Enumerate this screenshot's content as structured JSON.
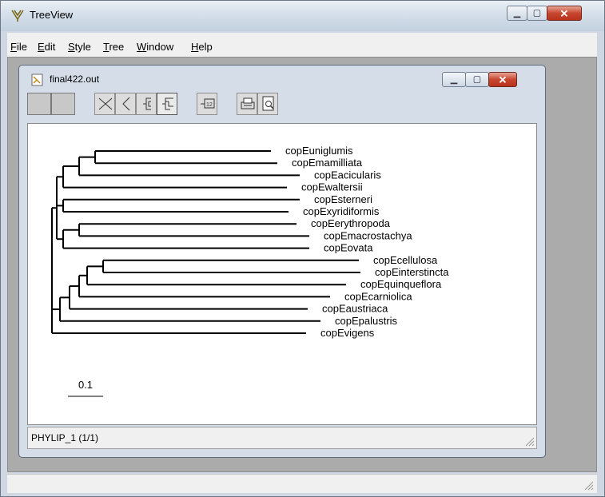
{
  "app": {
    "title": "TreeView"
  },
  "menu": [
    "File",
    "Edit",
    "Style",
    "Tree",
    "Window",
    "Help"
  ],
  "document": {
    "title": "final422.out",
    "status": "PHYLIP_1  (1/1)"
  },
  "toolbar": {
    "buttons": [
      "blank-button",
      "blank-button",
      "slanted-tree-button",
      "angle-tree-button",
      "rectangular-tree-button",
      "phylogram-button",
      "show-edge-labels-button",
      "print-button",
      "print-preview-button"
    ]
  },
  "tree": {
    "scale_label": "0.1",
    "taxa": [
      "copEuniglumis",
      "copEmamilliata",
      "copEacicularis",
      "copEwaltersii",
      "copEsterneri",
      "copExyridiformis",
      "copEerythropoda",
      "copEmacrostachya",
      "copEovata",
      "copEcellulosa",
      "copEinterstincta",
      "copEquinqueflora",
      "copEcarniolica",
      "copEaustriaca",
      "copEpalustris",
      "copEvigens"
    ]
  },
  "colors": {
    "accent_close": "#c8462f",
    "titlebar": "#cfdbe7"
  }
}
